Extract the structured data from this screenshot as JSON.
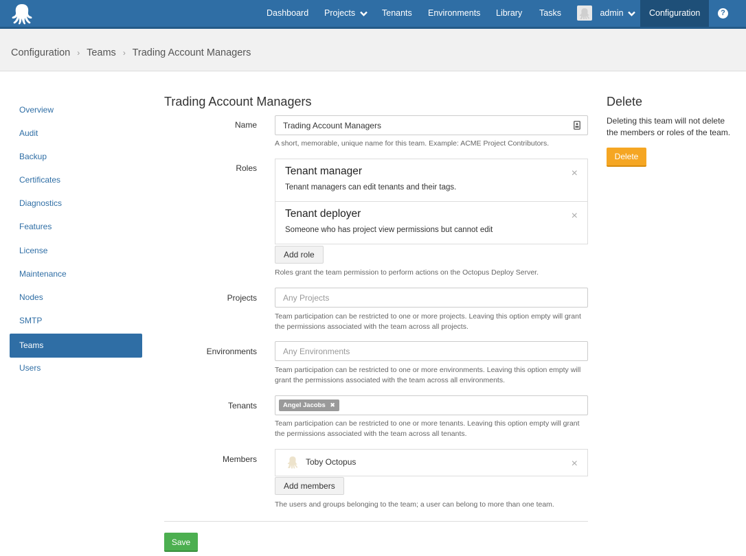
{
  "nav": {
    "logo_icon": "octopus-logo-icon",
    "items": {
      "dashboard": "Dashboard",
      "projects": "Projects",
      "tenants": "Tenants",
      "environments": "Environments",
      "library": "Library",
      "tasks": "Tasks",
      "user": "admin",
      "configuration": "Configuration"
    },
    "help_glyph": "?"
  },
  "breadcrumb": {
    "items": [
      "Configuration",
      "Teams",
      "Trading Account Managers"
    ],
    "separator": "›"
  },
  "sidebar": {
    "items": [
      "Overview",
      "Audit",
      "Backup",
      "Certificates",
      "Diagnostics",
      "Features",
      "License",
      "Maintenance",
      "Nodes",
      "SMTP",
      "Teams",
      "Users"
    ],
    "active": "Teams"
  },
  "form": {
    "title": "Trading Account Managers",
    "name": {
      "label": "Name",
      "value": "Trading Account Managers",
      "help": "A short, memorable, unique name for this team. Example: ACME Project Contributors."
    },
    "roles": {
      "label": "Roles",
      "items": [
        {
          "title": "Tenant manager",
          "description": "Tenant managers can edit tenants and their tags."
        },
        {
          "title": "Tenant deployer",
          "description": "Someone who has project view permissions but cannot edit"
        }
      ],
      "add_button": "Add role",
      "help": "Roles grant the team permission to perform actions on the Octopus Deploy Server."
    },
    "projects": {
      "label": "Projects",
      "placeholder": "Any Projects",
      "help": "Team participation can be restricted to one or more projects. Leaving this option empty will grant the permissions associated with the team across all projects."
    },
    "environments": {
      "label": "Environments",
      "placeholder": "Any Environments",
      "help": "Team participation can be restricted to one or more environments. Leaving this option empty will grant the permissions associated with the team across all environments."
    },
    "tenants": {
      "label": "Tenants",
      "tags": [
        "Angel Jacobs"
      ],
      "tag_remove_glyph": "✖",
      "help": "Team participation can be restricted to one or more tenants. Leaving this option empty will grant the permissions associated with the team across all tenants."
    },
    "members": {
      "label": "Members",
      "items": [
        {
          "name": "Toby Octopus",
          "icon": "octopus-avatar-icon"
        }
      ],
      "add_button": "Add members",
      "help": "The users and groups belonging to the team; a user can belong to more than one team."
    },
    "remove_glyph": "×",
    "save_button": "Save"
  },
  "delete_panel": {
    "title": "Delete",
    "text": "Deleting this team will not delete the members or roles of the team.",
    "button": "Delete"
  },
  "colors": {
    "nav_bg": "#2f6ea5",
    "nav_active_bg": "#1e4f78",
    "sidebar_active_bg": "#2f6ea5",
    "save_green": "#4caf50",
    "delete_orange": "#f5a623",
    "tag_gray": "#9a9a9a"
  }
}
